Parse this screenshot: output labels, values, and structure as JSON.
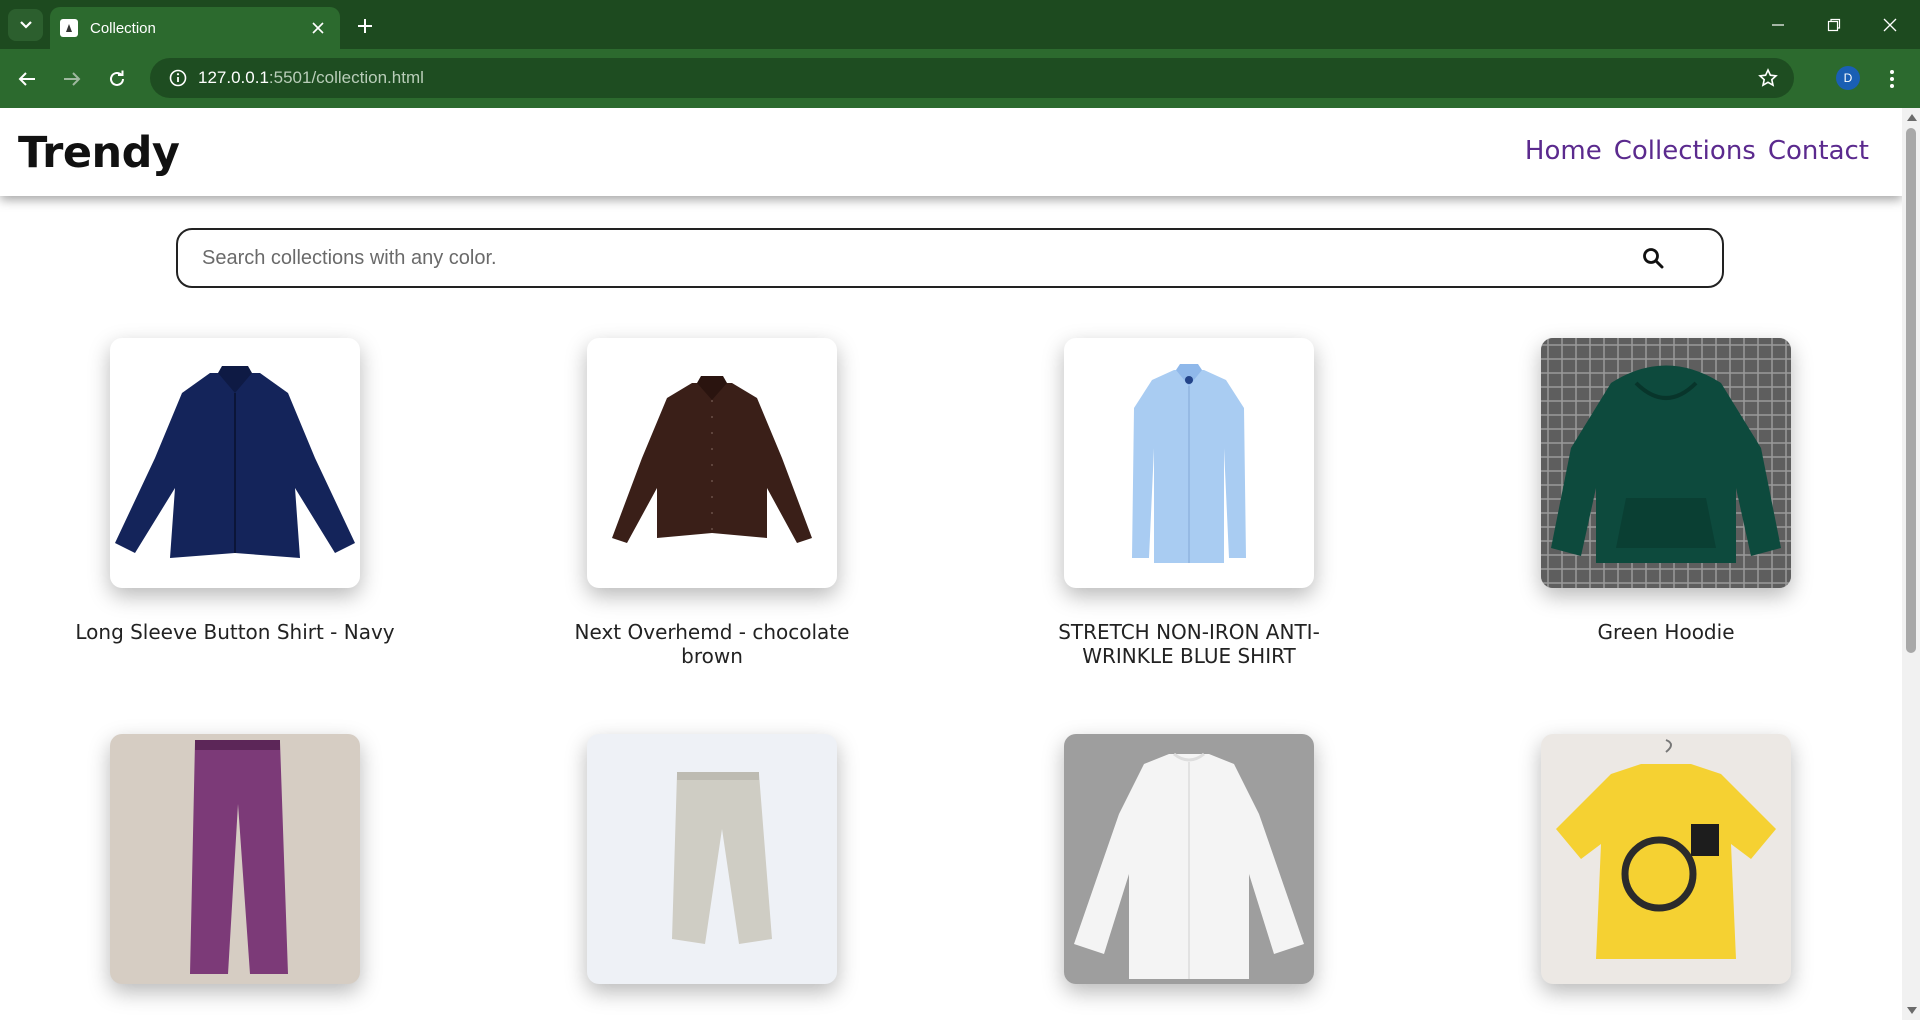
{
  "browser": {
    "tab_title": "Collection",
    "url_host": "127.0.0.1",
    "url_path": ":5501/collection.html",
    "profile_initial": "D"
  },
  "site": {
    "logo": "Trendy",
    "nav": [
      "Home",
      "Collections",
      "Contact"
    ],
    "search_placeholder": "Search collections with any color."
  },
  "products": [
    {
      "name": "Long Sleeve Button Shirt - Navy",
      "image": "navy-shirt"
    },
    {
      "name": "Next Overhemd - chocolate brown",
      "image": "brown-shirt"
    },
    {
      "name": "STRETCH NON-IRON ANTI-WRINKLE BLUE SHIRT",
      "image": "blue-shirt"
    },
    {
      "name": "Green Hoodie",
      "image": "green-hoodie"
    },
    {
      "name": "",
      "image": "purple-trousers"
    },
    {
      "name": "",
      "image": "beige-trousers"
    },
    {
      "name": "",
      "image": "white-shirt"
    },
    {
      "name": "",
      "image": "yellow-tshirt"
    }
  ]
}
